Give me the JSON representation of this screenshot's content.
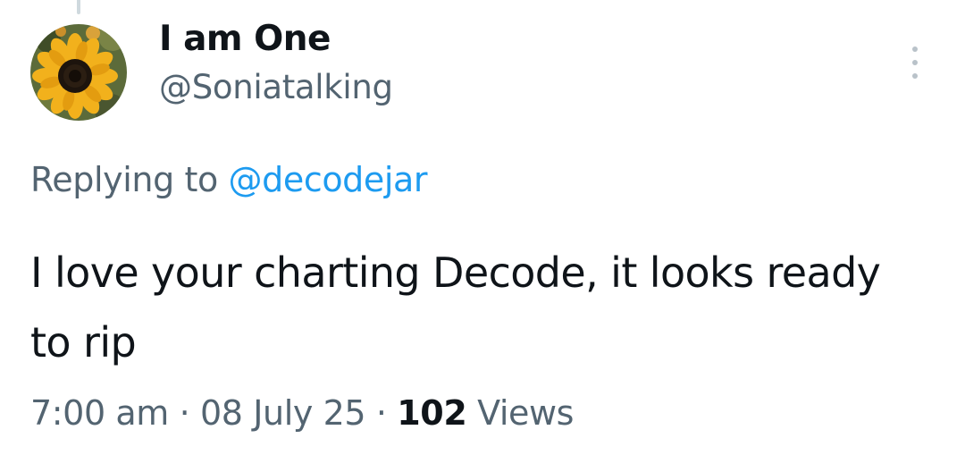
{
  "author": {
    "display_name": "I am One",
    "handle": "@Soniatalking",
    "avatar_icon": "sunflower-avatar"
  },
  "more_icon": "more-vertical-icon",
  "reply": {
    "prefix": "Replying to",
    "mention": "@decodejar"
  },
  "tweet": {
    "text": "I love your charting Decode, it looks ready to rip"
  },
  "meta": {
    "time": "7:00 am",
    "separator": "·",
    "date": "08 July 25",
    "views_count": "102",
    "views_label": "Views"
  },
  "colors": {
    "text_primary": "#0f1419",
    "text_secondary": "#536471",
    "link": "#1d9bf0"
  }
}
